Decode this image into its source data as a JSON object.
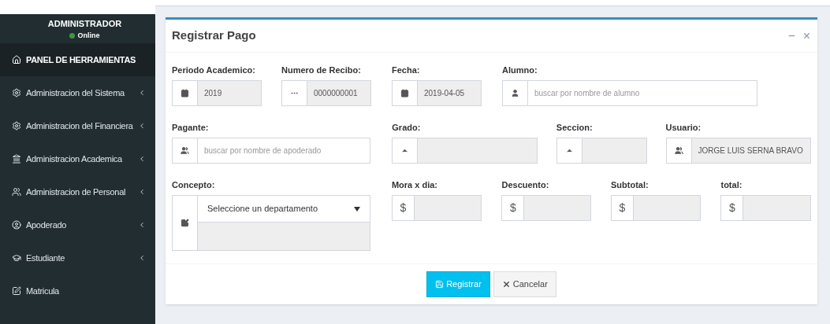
{
  "sidebar": {
    "user": {
      "name": "ADMINISTRADOR",
      "status": "Online"
    },
    "items": [
      {
        "label": "PANEL DE HERRAMIENTAS",
        "selected": true,
        "expandable": false
      },
      {
        "label": "Administracion del Sistema",
        "selected": false,
        "expandable": true
      },
      {
        "label": "Administracion del Financiera",
        "selected": false,
        "expandable": true
      },
      {
        "label": "Administracion Academica",
        "selected": false,
        "expandable": true
      },
      {
        "label": "Administracion de Personal",
        "selected": false,
        "expandable": true
      },
      {
        "label": "Apoderado",
        "selected": false,
        "expandable": true
      },
      {
        "label": "Estudiante",
        "selected": false,
        "expandable": true
      },
      {
        "label": "Matricula",
        "selected": false,
        "expandable": false
      }
    ]
  },
  "box": {
    "title": "Registrar Pago",
    "fields": [
      {
        "label": "Periodo Academico:",
        "value": "2019",
        "readonly": true
      },
      {
        "label": "Numero de Recibo:",
        "value": "0000000001",
        "readonly": true
      },
      {
        "label": "Fecha:",
        "value": "2019-04-05",
        "readonly": true
      },
      {
        "label": "Alumno:",
        "placeholder": "buscar por nombre de alumno",
        "readonly": false
      },
      {
        "label": "Pagante:",
        "placeholder": "buscar por nombre de apoderado",
        "readonly": false
      },
      {
        "label": "Grado:",
        "readonly": true
      },
      {
        "label": "Seccion:",
        "readonly": true
      },
      {
        "label": "Usuario:",
        "value": "JORGE LUIS SERNA BRAVO",
        "readonly": true
      },
      {
        "label": "Concepto:",
        "kind": "select",
        "value": "Seleccione un departamento",
        "readonly": false
      },
      {
        "label": "Mora x dia:",
        "prefix": "$",
        "readonly": true
      },
      {
        "label": "Descuento:",
        "prefix": "$",
        "readonly": true
      },
      {
        "label": "Subtotal:",
        "prefix": "$",
        "readonly": true
      },
      {
        "label": "total:",
        "prefix": "$",
        "readonly": true
      }
    ],
    "buttons": [
      {
        "label": "Registrar",
        "kind": "primary"
      },
      {
        "label": "Cancelar",
        "kind": "default"
      }
    ]
  }
}
